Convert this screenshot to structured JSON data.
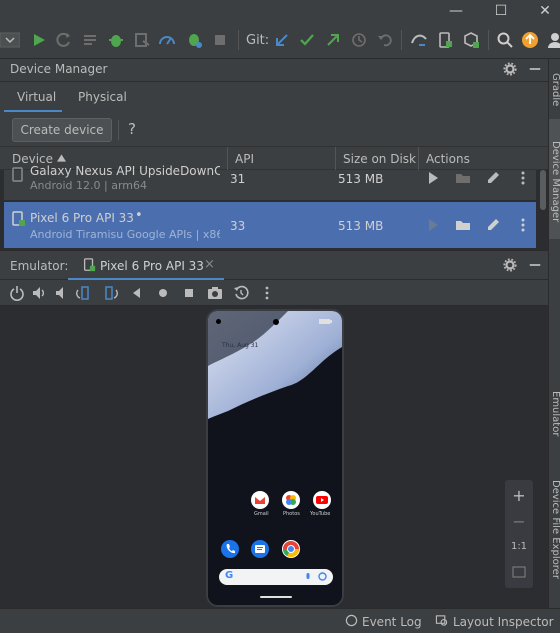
{
  "toolbar": {
    "git_label": "Git:"
  },
  "device_manager": {
    "title": "Device Manager",
    "tabs": [
      "Virtual",
      "Physical"
    ],
    "create_button": "Create device",
    "help_label": "?",
    "columns": [
      "Device",
      "API",
      "Size on Disk",
      "Actions"
    ],
    "rows": [
      {
        "name": "Galaxy Nexus API UpsideDownC...",
        "sub": "Android 12.0 | arm64",
        "api": "31",
        "size": "513 MB"
      },
      {
        "name": "Pixel 6 Pro API 33",
        "online_dot": "•",
        "sub": "Android Tiramisu Google APIs | x86...",
        "api": "33",
        "size": "513 MB"
      }
    ]
  },
  "emulator": {
    "label": "Emulator:",
    "tab_name": "Pixel 6 Pro API 33",
    "tab_close": "×"
  },
  "phone": {
    "date_text": "Thu, Aug 31",
    "apps_row1": [
      "Gmail",
      "Photos",
      "YouTube"
    ],
    "google_g": "G"
  },
  "zoom": {
    "plus": "+",
    "minus": "−",
    "one_to_one": "1:1"
  },
  "side_tabs": [
    "Gradle",
    "Device Manager",
    "Emulator",
    "Device File Explorer"
  ],
  "status": {
    "event_log": "Event Log",
    "layout_inspector": "Layout Inspector"
  },
  "window": {
    "minimize": "—",
    "maximize": "☐",
    "close": "✕"
  },
  "colors": {
    "selection": "#4b6eaf",
    "accent": "#4a88c7",
    "run_green": "#4fa64f",
    "warning_orange": "#f0a030"
  }
}
